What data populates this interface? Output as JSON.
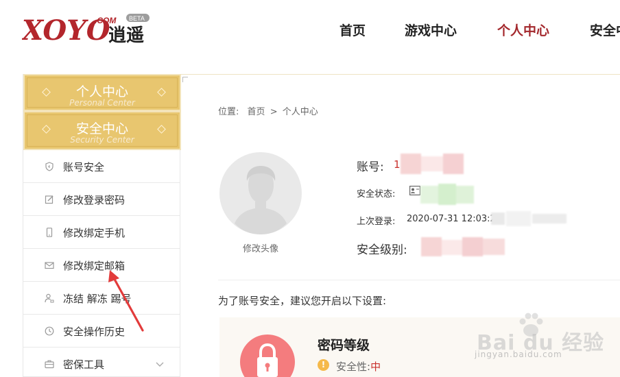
{
  "header": {
    "logo": {
      "brand": "XOYO",
      "dotcom": ".COM",
      "beta": "BETA",
      "cn": "逍遥"
    },
    "nav": [
      {
        "label": "首页",
        "active": false
      },
      {
        "label": "游戏中心",
        "active": false
      },
      {
        "label": "个人中心",
        "active": true
      },
      {
        "label": "安全中",
        "active": false
      }
    ],
    "accent_color": "#a3282d"
  },
  "sidebar": {
    "heads": [
      {
        "cn": "个人中心",
        "en": "Personal Center"
      },
      {
        "cn": "安全中心",
        "en": "Security Center"
      }
    ],
    "items": [
      {
        "label": "账号安全",
        "icon": "shield-icon"
      },
      {
        "label": "修改登录密码",
        "icon": "edit-icon"
      },
      {
        "label": "修改绑定手机",
        "icon": "phone-icon"
      },
      {
        "label": "修改绑定邮箱",
        "icon": "mail-icon"
      },
      {
        "label": "冻结 解冻 踢号",
        "icon": "user-lock-icon"
      },
      {
        "label": "安全操作历史",
        "icon": "clock-icon"
      },
      {
        "label": "密保工具",
        "icon": "toolbox-icon"
      }
    ],
    "head_color": "#e8c66f"
  },
  "breadcrumb": {
    "prefix": "位置:",
    "home": "首页",
    "separator": ">",
    "current": "个人中心"
  },
  "profile": {
    "avatar_label": "修改头像",
    "account_label": "账号:",
    "account_value": "1",
    "status_label": "安全状态:",
    "last_login_label": "上次登录:",
    "last_login_value": "2020-07-31 12:03:2",
    "level_label": "安全级别:"
  },
  "tip": "为了账号安全，建议您开启以下设置:",
  "password_card": {
    "title": "密码等级",
    "safety_label": "安全性:",
    "safety_value": "中",
    "icon": "lock-icon",
    "warn_icon_text": "!"
  },
  "watermark": {
    "text": "Bai du 经验",
    "url": "jingyan.baidu.com"
  }
}
